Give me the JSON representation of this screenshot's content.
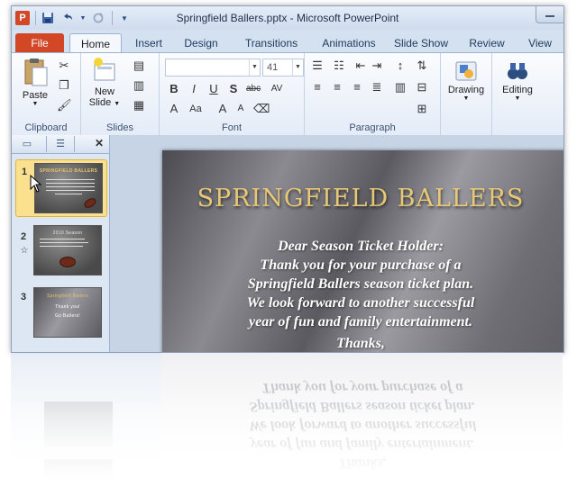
{
  "window": {
    "title": "Springfield Ballers.pptx - Microsoft PowerPoint",
    "app_icon_letter": "P"
  },
  "quick_access": [
    "save-icon",
    "undo-icon",
    "redo-icon",
    "customize-icon"
  ],
  "tabs": [
    {
      "label": "File"
    },
    {
      "label": "Home"
    },
    {
      "label": "Insert"
    },
    {
      "label": "Design"
    },
    {
      "label": "Transitions"
    },
    {
      "label": "Animations"
    },
    {
      "label": "Slide Show"
    },
    {
      "label": "Review"
    },
    {
      "label": "View"
    }
  ],
  "ribbon": {
    "clipboard": {
      "label": "Clipboard",
      "paste": "Paste"
    },
    "slides": {
      "label": "Slides",
      "new_slide_line1": "New",
      "new_slide_line2": "Slide"
    },
    "font": {
      "label": "Font",
      "font_name": "",
      "font_size": "41"
    },
    "paragraph": {
      "label": "Paragraph"
    },
    "drawing": {
      "label": "Drawing"
    },
    "editing": {
      "label": "Editing"
    }
  },
  "slides_panel": {
    "thumbnails": [
      {
        "number": "1",
        "title": "SPRINGFIELD BALLERS"
      },
      {
        "number": "2",
        "title": "2010 Season"
      },
      {
        "number": "3",
        "title": "Springfield Ballers",
        "line1": "Thank you!",
        "line2": "Go Ballers!"
      }
    ]
  },
  "slide": {
    "title": "SPRINGFIELD BALLERS",
    "body": [
      "Dear Season Ticket Holder:",
      "Thank you for your purchase of a",
      "Springfield Ballers season ticket plan.",
      "We look forward to another successful",
      "year of fun and family entertainment.",
      "Thanks,"
    ]
  },
  "colors": {
    "file_tab": "#d24726",
    "title_gold": "#e8c877",
    "ribbon_border": "#9db2d0"
  }
}
